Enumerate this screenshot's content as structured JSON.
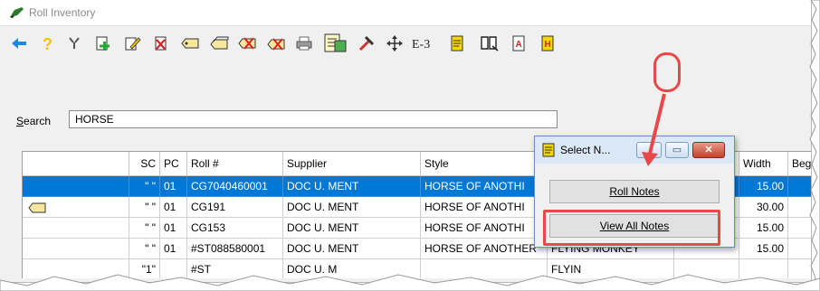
{
  "window": {
    "title": "Roll Inventory"
  },
  "toolbar": {
    "items": [
      {
        "icon": "back-arrow-icon"
      },
      {
        "icon": "help-icon"
      },
      {
        "icon": "tool-icon"
      },
      {
        "icon": "add-icon"
      },
      {
        "icon": "edit-icon"
      },
      {
        "icon": "delete-icon"
      },
      {
        "icon": "tag-icon"
      },
      {
        "icon": "tags-icon"
      },
      {
        "icon": "tag-remove-icon"
      },
      {
        "icon": "tags-remove-icon"
      },
      {
        "icon": "print-icon"
      },
      {
        "icon": "notes-list-icon"
      },
      {
        "icon": "tools-icon"
      },
      {
        "icon": "move-icon"
      },
      {
        "icon": "e3-icon"
      },
      {
        "icon": "notes-icon"
      },
      {
        "icon": "book-icon"
      },
      {
        "icon": "report-a-icon"
      },
      {
        "icon": "report-h-icon"
      }
    ],
    "e3_label": "E-3"
  },
  "search": {
    "label_first": "S",
    "label_rest": "earch",
    "value": "HORSE"
  },
  "grid": {
    "columns": [
      "",
      "SC",
      "PC",
      "Roll #",
      "Supplier",
      "Style",
      "Width",
      "Beg"
    ],
    "rows": [
      {
        "sc": "\" \"",
        "pc": "01",
        "roll": "CG7040460001",
        "supplier": "DOC U. MENT",
        "style": "HORSE OF ANOTHI",
        "color": "",
        "width": "15.00",
        "selected": true
      },
      {
        "sc": "\" \"",
        "pc": "01",
        "roll": "CG191",
        "supplier": "DOC U. MENT",
        "style": "HORSE OF ANOTHI",
        "color": "",
        "width": "30.00",
        "tag": true
      },
      {
        "sc": "\" \"",
        "pc": "01",
        "roll": "CG153",
        "supplier": "DOC U. MENT",
        "style": "HORSE OF ANOTHI",
        "color": "",
        "width": "15.00"
      },
      {
        "sc": "\" \"",
        "pc": "01",
        "roll": "#ST088580001",
        "supplier": "DOC U. MENT",
        "style": "HORSE OF ANOTHER",
        "color": "FLYING MONKEY",
        "width": "15.00"
      },
      {
        "sc": "\"1\"",
        "pc": "",
        "roll": "#ST",
        "supplier": "DOC U. M",
        "style": "",
        "color": "FLYIN",
        "width": ""
      }
    ]
  },
  "dialog": {
    "title": "Select N...",
    "roll_notes": "Roll Notes",
    "view_all_notes": "View All Notes"
  },
  "colors": {
    "selection": "#0078d7",
    "highlight": "#e8484a"
  }
}
